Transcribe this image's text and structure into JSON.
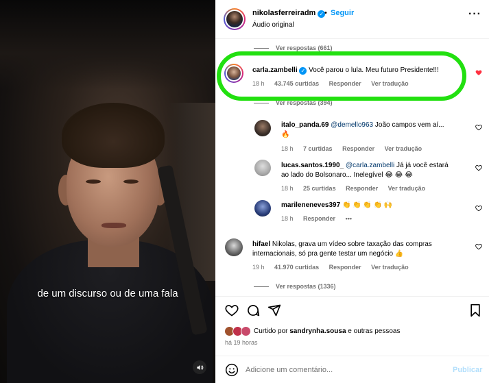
{
  "video": {
    "caption": "de um discurso ou de uma fala",
    "sound_icon": "speaker-icon"
  },
  "header": {
    "username": "nikolasferreiradm",
    "separator": "•",
    "follow_label": "Seguir",
    "subtitle": "Áudio original",
    "more_icon": "more-horizontal-icon"
  },
  "threads": {
    "view_replies_1": "Ver respostas (661)",
    "view_replies_2": "Ver respostas (394)",
    "view_replies_3": "Ver respostas (1336)"
  },
  "comments": [
    {
      "user": "carla.zambelli",
      "verified": true,
      "text": "Você parou o lula. Meu futuro Presidente!!!",
      "time": "18 h",
      "likes": "43.745 curtidas",
      "reply": "Responder",
      "translate": "Ver tradução",
      "liked": true
    },
    {
      "user": "italo_panda.69",
      "mention": "@demello963",
      "text": "João campos vem aí...",
      "emoji": "🔥",
      "time": "18 h",
      "likes": "7 curtidas",
      "reply": "Responder",
      "translate": "Ver tradução"
    },
    {
      "user": "lucas.santos.1990_",
      "mention": "@carla.zambelli",
      "text_1": "Já já você estará",
      "text_2": "ao lado do Bolsonaro... Inelegível 😂 😂 😂",
      "time": "18 h",
      "likes": "25 curtidas",
      "reply": "Responder",
      "translate": "Ver tradução"
    },
    {
      "user": "marileneneves397",
      "text": "👏 👏 👏 👏 🙌",
      "time": "18 h",
      "reply": "Responder",
      "more": "•••"
    },
    {
      "user": "hifael",
      "text_1": "Nikolas, grava um vídeo sobre taxação das compras",
      "text_2": "internacionais, só pra gente testar um negócio 👍",
      "time": "19 h",
      "likes": "41.970 curtidas",
      "reply": "Responder",
      "translate": "Ver tradução"
    }
  ],
  "actions": {
    "liked_by_prefix": "Curtido por",
    "liked_by_user": "sandrynha.sousa",
    "liked_by_suffix": "e outras pessoas",
    "time_ago": "há 19 horas"
  },
  "add_comment": {
    "placeholder": "Adicione um comentário...",
    "publish_label": "Publicar"
  },
  "colors": {
    "accent": "#0095f6",
    "highlight": "#22e010",
    "like_red": "#ff3040"
  }
}
